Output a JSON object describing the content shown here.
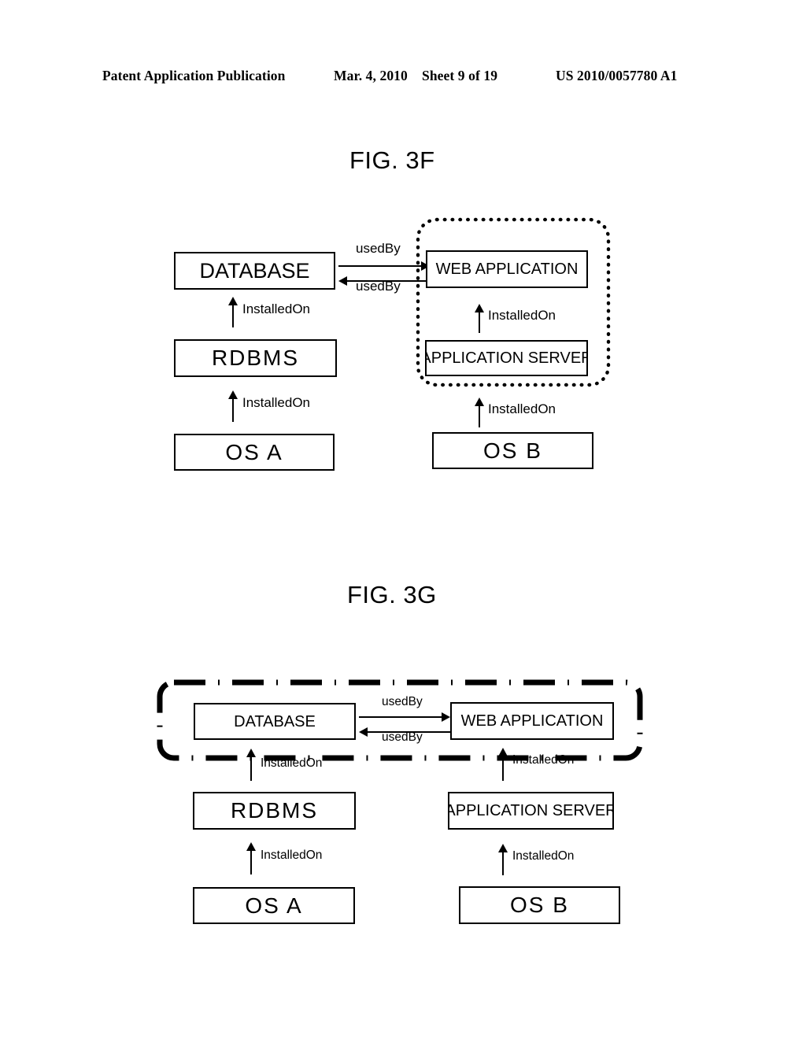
{
  "header": {
    "publication": "Patent Application Publication",
    "date": "Mar. 4, 2010",
    "sheet": "Sheet 9 of 19",
    "publication_number": "US 2010/0057780 A1"
  },
  "figures": [
    {
      "id": "fig-3f",
      "title": "FIG. 3F",
      "group_boundary": {
        "style": "dotted-rounded",
        "encloses": [
          "WEB APPLICATION",
          "APPLICATION SERVER"
        ]
      },
      "nodes": {
        "database": "DATABASE",
        "rdbms": "RDBMS",
        "os_a": "OS  A",
        "web_application": "WEB APPLICATION",
        "application_server": "APPLICATION SERVER",
        "os_b": "OS  B"
      },
      "edges": {
        "db_to_web": "usedBy",
        "web_to_db": "usedBy",
        "rdbms_to_db": "InstalledOn",
        "osa_to_rdbms": "InstalledOn",
        "appsrv_to_web": "InstalledOn",
        "osb_to_appsrv": "InstalledOn"
      }
    },
    {
      "id": "fig-3g",
      "title": "FIG. 3G",
      "group_boundary": {
        "style": "dash-dot-rounded",
        "encloses": [
          "DATABASE",
          "WEB APPLICATION"
        ]
      },
      "nodes": {
        "database": "DATABASE",
        "rdbms": "RDBMS",
        "os_a": "OS  A",
        "web_application": "WEB APPLICATION",
        "application_server": "APPLICATION SERVER",
        "os_b": "OS  B"
      },
      "edges": {
        "db_to_web": "usedBy",
        "web_to_db": "usedBy",
        "rdbms_to_db": "InstalledOn",
        "osa_to_rdbms": "InstalledOn",
        "appsrv_to_web": "InstalledOn",
        "osb_to_appsrv": "InstalledOn"
      }
    }
  ],
  "colors": {
    "ink": "#000000",
    "paper": "#ffffff"
  }
}
